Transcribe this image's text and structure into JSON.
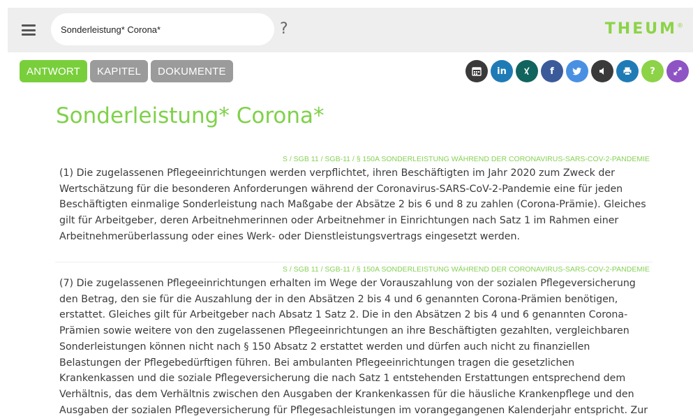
{
  "header": {
    "search_value": "Sonderleistung* Corona*",
    "help_label": "?",
    "logo_text": "THEUM",
    "logo_mark": "®"
  },
  "tabs": [
    {
      "label": "ANTWORT",
      "active": true
    },
    {
      "label": "KAPITEL",
      "active": false
    },
    {
      "label": "DOKUMENTE",
      "active": false
    }
  ],
  "share_buttons": [
    {
      "name": "calendar-icon",
      "color": "#3a3a3a"
    },
    {
      "name": "linkedin-icon",
      "text": "in",
      "color": "#1f7bb6"
    },
    {
      "name": "xing-icon",
      "color": "#12645e"
    },
    {
      "name": "facebook-icon",
      "text": "f",
      "color": "#3b5a9a"
    },
    {
      "name": "twitter-icon",
      "color": "#4a90e2"
    },
    {
      "name": "speaker-icon",
      "color": "#3a3a3a"
    },
    {
      "name": "print-icon",
      "color": "#1f7bb6"
    },
    {
      "name": "help-icon",
      "text": "?",
      "color": "#8cd347"
    },
    {
      "name": "fullscreen-icon",
      "color": "#8e54c4"
    }
  ],
  "main": {
    "title": "Sonderleistung* Corona*",
    "articles": [
      {
        "source": "S / SGB 11 / SGB-11 / § 150A SONDERLEISTUNG WÄHREND DER CORONAVIRUS-SARS-COV-2-PANDEMIE",
        "text": "(1) Die zugelassenen Pflegeeinrichtungen werden verpflichtet, ihren Beschäftigten im Jahr 2020 zum Zweck der Wertschätzung für die besonderen Anforderungen während der Coronavirus-SARS-CoV-2-Pandemie eine für jeden Beschäftigten einmalige Sonderleistung nach Maßgabe der Absätze 2 bis 6 und 8 zu zahlen (Corona-Prämie). Gleiches gilt für Arbeitgeber, deren Arbeitnehmerinnen oder Arbeitnehmer in Einrichtungen nach Satz 1 im Rahmen einer Arbeitnehmerüberlassung oder eines Werk- oder Dienstleistungsvertrags eingesetzt werden."
      },
      {
        "source": "S / SGB 11 / SGB-11 / § 150A SONDERLEISTUNG WÄHREND DER CORONAVIRUS-SARS-COV-2-PANDEMIE",
        "text": "(7) Die zugelassenen Pflegeeinrichtungen erhalten im Wege der Vorauszahlung von der sozialen Pflegeversicherung den Betrag, den sie für die Auszahlung der in den Absätzen 2 bis 4 und 6 genannten Corona-Prämien benötigen, erstattet. Gleiches gilt für Arbeitgeber nach Absatz 1 Satz 2. Die in den Absätzen 2 bis 4 und 6 genannten Corona-Prämien sowie weitere von den zugelassenen Pflegeeinrichtungen an ihre Beschäftigten gezahlten, vergleichbaren Sonderleistungen können nicht nach § 150 Absatz 2 erstattet werden und dürfen auch nicht zu finanziellen Belastungen der Pflegebedürftigen führen. Bei ambulanten Pflegeeinrichtungen tragen die gesetzlichen Krankenkassen und die soziale Pflegeversicherung die nach Satz 1 entstehenden Erstattungen entsprechend dem Verhältnis, das dem Verhältnis zwischen den Ausgaben der Krankenkassen für die häusliche Krankenpflege und den Ausgaben der sozialen Pflegeversicherung für Pflegesachleistungen im vorangegangenen Kalenderjahr entspricht. Zur Finanzierung der den"
      }
    ]
  }
}
